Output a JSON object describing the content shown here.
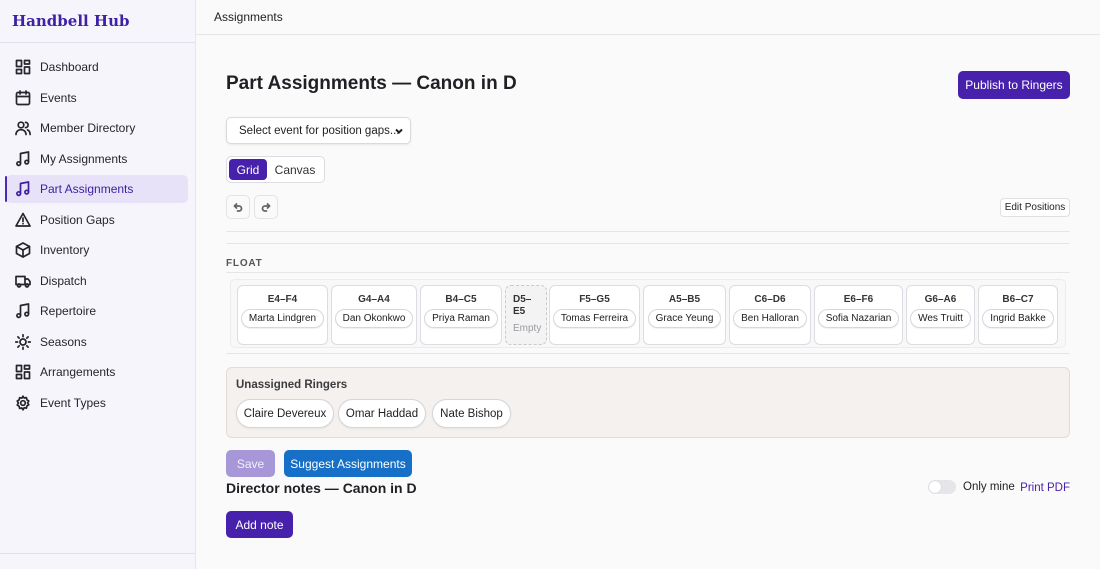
{
  "app": {
    "brand": "Handbell Hub"
  },
  "colors": {
    "accent": "#4721ab",
    "suggest": "#1670c7",
    "save_disabled": "#a797d8",
    "unassigned_bg": "#f4f1ee"
  },
  "sidebar": {
    "items": [
      {
        "label": "Dashboard",
        "icon": "dashboard-icon"
      },
      {
        "label": "Events",
        "icon": "calendar-icon"
      },
      {
        "label": "Member Directory",
        "icon": "users-icon"
      },
      {
        "label": "My Assignments",
        "icon": "music-note-icon"
      },
      {
        "label": "Part Assignments",
        "icon": "music-note-icon",
        "active": true
      },
      {
        "label": "Position Gaps",
        "icon": "warning-icon"
      },
      {
        "label": "Inventory",
        "icon": "box-icon"
      },
      {
        "label": "Dispatch",
        "icon": "truck-icon"
      },
      {
        "label": "Repertoire",
        "icon": "music-note-icon"
      },
      {
        "label": "Seasons",
        "icon": "sun-icon"
      },
      {
        "label": "Arrangements",
        "icon": "dashboard-icon"
      },
      {
        "label": "Event Types",
        "icon": "gear-icon"
      }
    ]
  },
  "topbar": {
    "breadcrumb": "Assignments"
  },
  "page": {
    "title": "Part Assignments — Canon in D",
    "publish_label": "Publish to Ringers",
    "event_select": {
      "value": "Select event for position gaps..."
    },
    "view_toggle": {
      "grid": "Grid",
      "canvas": "Canvas",
      "active": "Grid"
    },
    "edit_positions_label": "Edit Positions",
    "float_label": "FLOAT",
    "positions": [
      {
        "range": "E4–F4",
        "ringer": "Marta Lindgren"
      },
      {
        "range": "G4–A4",
        "ringer": "Dan Okonkwo"
      },
      {
        "range": "B4–C5",
        "ringer": "Priya Raman"
      },
      {
        "range_line1": "D5–",
        "range_line2": "E5",
        "empty_text": "Empty"
      },
      {
        "range": "F5–G5",
        "ringer": "Tomas Ferreira"
      },
      {
        "range": "A5–B5",
        "ringer": "Grace Yeung"
      },
      {
        "range": "C6–D6",
        "ringer": "Ben Halloran"
      },
      {
        "range": "E6–F6",
        "ringer": "Sofia Nazarian"
      },
      {
        "range": "G6–A6",
        "ringer": "Wes Truitt"
      },
      {
        "range": "B6–C7",
        "ringer": "Ingrid Bakke"
      }
    ],
    "unassigned": {
      "title": "Unassigned Ringers",
      "ringers": [
        "Claire Devereux",
        "Omar Haddad",
        "Nate Bishop"
      ]
    },
    "save_label": "Save",
    "suggest_label": "Suggest Assignments",
    "notes": {
      "title": "Director notes — Canon in D",
      "only_mine_label": "Only mine",
      "only_mine_checked": false,
      "print_label": "Print PDF",
      "add_note_label": "Add note"
    }
  }
}
